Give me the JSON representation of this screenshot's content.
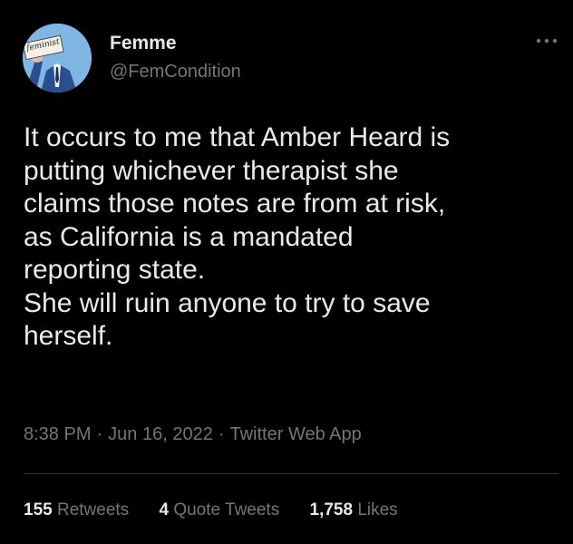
{
  "user": {
    "display_name": "Femme",
    "handle": "@FemCondition",
    "avatar": {
      "icon": "feminist-sign-avatar-icon",
      "sign_text": "feminist",
      "background_color": "#7fb6e4"
    }
  },
  "tweet": {
    "lines": [
      "It occurs to me that Amber Heard is",
      "putting whichever therapist she",
      "claims those notes are from at risk,",
      "as California is a mandated",
      "reporting state.",
      "She will ruin anyone to try to save",
      "herself."
    ]
  },
  "meta": {
    "time": "8:38 PM",
    "separator": "·",
    "date": "Jun 16, 2022",
    "source": "Twitter Web App"
  },
  "stats": {
    "retweets": {
      "count": "155",
      "label": "Retweets"
    },
    "quote_tweets": {
      "count": "4",
      "label": "Quote Tweets"
    },
    "likes": {
      "count": "1,758",
      "label": "Likes"
    }
  },
  "icons": {
    "more": "more-options-icon"
  },
  "colors": {
    "background": "#000000",
    "primary_text": "#e7e9ea",
    "secondary_text": "#71767b",
    "divider": "#2f3336"
  }
}
